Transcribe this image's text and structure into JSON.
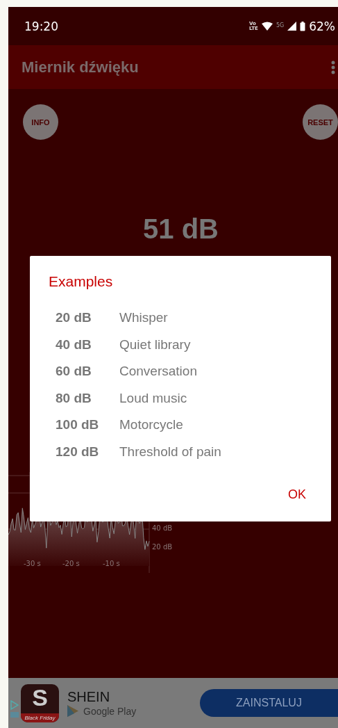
{
  "status_bar": {
    "time": "19:20",
    "volte": [
      "Vo",
      "LTE"
    ],
    "network": "5G",
    "battery": "62%"
  },
  "app_bar": {
    "title": "Miernik dźwięku"
  },
  "meter": {
    "info_button": "INFO",
    "reset_button": "RESET",
    "reading": "51 dB",
    "history_graph": {
      "y_labels": [
        "40 dB",
        "20 dB"
      ],
      "x_labels": [
        "-30 s",
        "-20 s",
        "-10 s"
      ]
    }
  },
  "dialog": {
    "title": "Examples",
    "rows": [
      {
        "level": "20 dB",
        "label": "Whisper"
      },
      {
        "level": "40 dB",
        "label": "Quiet library"
      },
      {
        "level": "60 dB",
        "label": "Conversation"
      },
      {
        "level": "80 dB",
        "label": "Loud music"
      },
      {
        "level": "100 dB",
        "label": "Motorcycle"
      },
      {
        "level": "120 dB",
        "label": "Threshold of pain"
      }
    ],
    "button": "OK"
  },
  "ad": {
    "app_name": "SHEIN",
    "icon_letter": "S",
    "icon_caption": "Black Friday",
    "store": "Google Play",
    "install_button": "ZAINSTALUJ"
  }
}
